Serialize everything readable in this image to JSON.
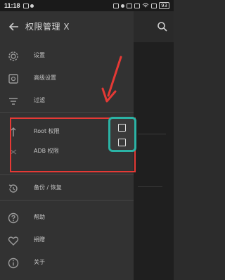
{
  "status_bar": {
    "time": "11:18",
    "battery": "93"
  },
  "header": {
    "title": "权限管理 X"
  },
  "menu": {
    "items": [
      {
        "label": "设置",
        "icon": "gear-icon"
      },
      {
        "label": "高级设置",
        "icon": "advanced-settings-icon"
      },
      {
        "label": "过滤",
        "icon": "filter-icon"
      },
      {
        "label": "Root 权限",
        "icon": "root-icon",
        "checked": false
      },
      {
        "label": "ADB 权限",
        "icon": "adb-icon",
        "checked": false
      },
      {
        "label": "备份 / 恢复",
        "icon": "backup-restore-icon"
      },
      {
        "label": "帮助",
        "icon": "help-icon"
      },
      {
        "label": "捐赠",
        "icon": "heart-icon"
      },
      {
        "label": "关于",
        "icon": "info-icon"
      }
    ]
  },
  "colors": {
    "highlight_red": "#e53935",
    "checkbox_panel_teal": "#2bb3a5"
  }
}
